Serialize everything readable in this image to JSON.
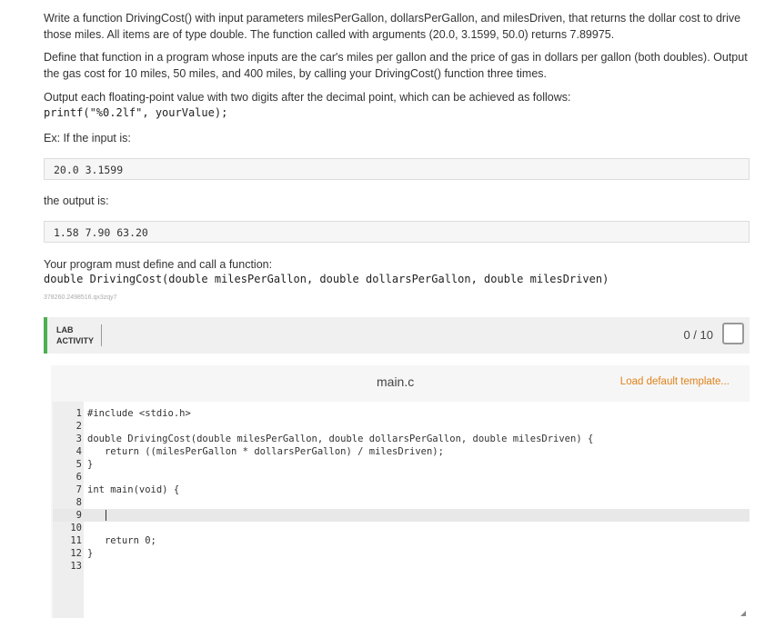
{
  "instructions": {
    "p1": "Write a function DrivingCost() with input parameters milesPerGallon, dollarsPerGallon, and milesDriven, that returns the dollar cost to drive those miles. All items are of type double. The function called with arguments (20.0, 3.1599, 50.0) returns 7.89975.",
    "p2": "Define that function in a program whose inputs are the car's miles per gallon and the price of gas in dollars per gallon (both doubles). Output the gas cost for 10 miles, 50 miles, and 400 miles, by calling your DrivingCost() function three times.",
    "p3": "Output each floating-point value with two digits after the decimal point, which can be achieved as follows:",
    "printf_code": "printf(\"%0.2lf\", yourValue);",
    "ex_label": "Ex: If the input is:",
    "example_input": "20.0 3.1599",
    "output_label": "the output is:",
    "example_output": "1.58 7.90 63.20",
    "must_define": "Your program must define and call a function:",
    "signature": "double DrivingCost(double milesPerGallon, double dollarsPerGallon, double milesDriven)",
    "activity_id": "378260.2498516.qx3zqy7"
  },
  "lab": {
    "label_line1": "LAB",
    "label_line2": "ACTIVITY",
    "score": "0 / 10",
    "accent_color": "#4caf50"
  },
  "editor": {
    "file_name": "main.c",
    "load_template": "Load default template...",
    "link_color": "#e0821b",
    "lines": [
      {
        "n": "1",
        "code": "#include <stdio.h>"
      },
      {
        "n": "2",
        "code": ""
      },
      {
        "n": "3",
        "code": "double DrivingCost(double milesPerGallon, double dollarsPerGallon, double milesDriven) {"
      },
      {
        "n": "4",
        "code": "   return ((milesPerGallon * dollarsPerGallon) / milesDriven);"
      },
      {
        "n": "5",
        "code": "}"
      },
      {
        "n": "6",
        "code": ""
      },
      {
        "n": "7",
        "code": "int main(void) {"
      },
      {
        "n": "8",
        "code": ""
      },
      {
        "n": "9",
        "code": "   "
      },
      {
        "n": "10",
        "code": ""
      },
      {
        "n": "11",
        "code": "   return 0;"
      },
      {
        "n": "12",
        "code": "}"
      },
      {
        "n": "13",
        "code": ""
      }
    ]
  }
}
